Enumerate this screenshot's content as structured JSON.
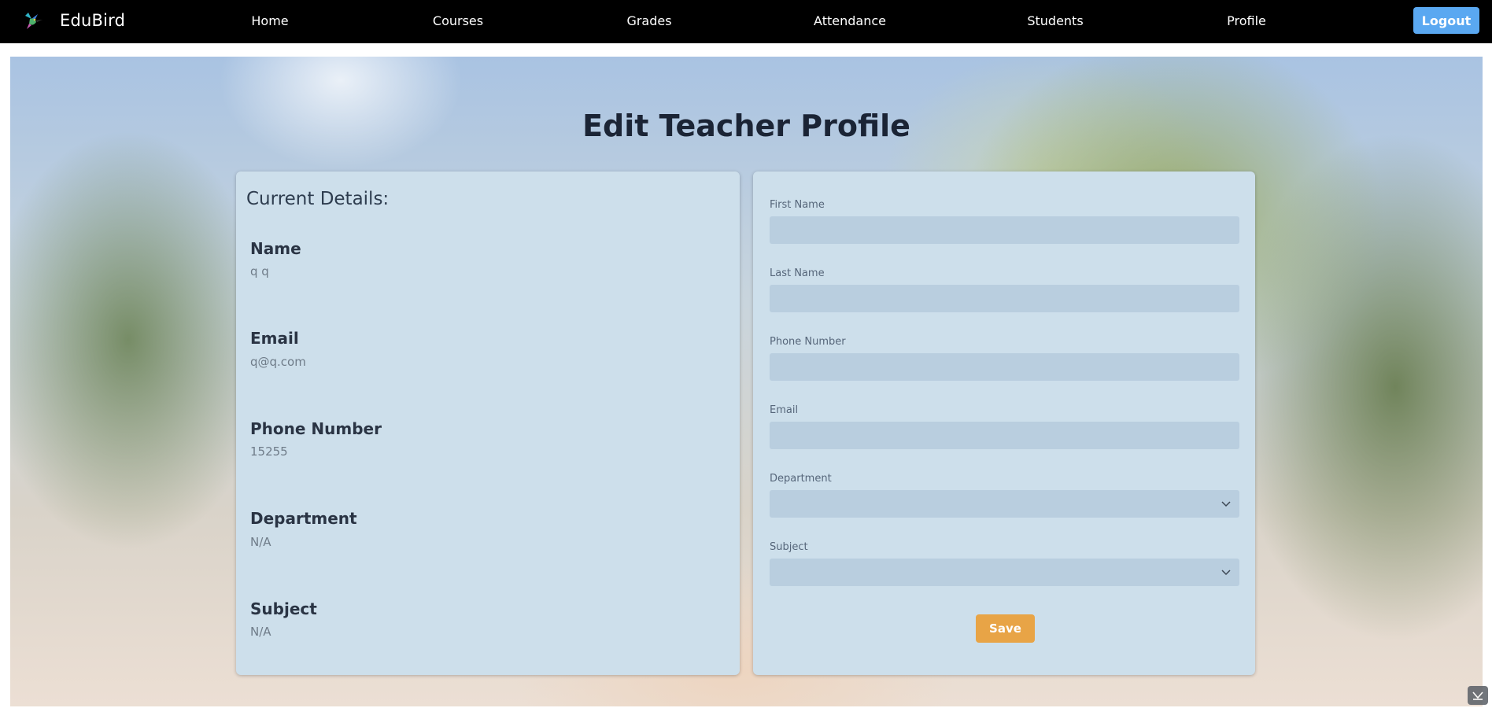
{
  "nav": {
    "brand": "EduBird",
    "links": [
      "Home",
      "Courses",
      "Grades",
      "Attendance",
      "Students",
      "Profile"
    ],
    "logout_label": "Logout"
  },
  "page": {
    "title": "Edit Teacher Profile"
  },
  "current_details": {
    "heading": "Current Details:",
    "items": [
      {
        "label": "Name",
        "value": "q q"
      },
      {
        "label": "Email",
        "value": "q@q.com"
      },
      {
        "label": "Phone Number",
        "value": "15255"
      },
      {
        "label": "Department",
        "value": "N/A"
      },
      {
        "label": "Subject",
        "value": "N/A"
      }
    ]
  },
  "form": {
    "first_name": {
      "label": "First Name",
      "value": ""
    },
    "last_name": {
      "label": "Last Name",
      "value": ""
    },
    "phone_number": {
      "label": "Phone Number",
      "value": ""
    },
    "email": {
      "label": "Email",
      "value": ""
    },
    "department": {
      "label": "Department",
      "selected": ""
    },
    "subject": {
      "label": "Subject",
      "selected": ""
    },
    "save_label": "Save"
  },
  "colors": {
    "navbar": "#000000",
    "logout_button": "#5aa8f1",
    "save_button": "#e8a446",
    "panel": "#cddfeb",
    "input": "#b9cedf",
    "title": "#1b2435"
  },
  "icons": {
    "brand": "hummingbird-logo-icon",
    "select_arrow": "chevron-down-icon",
    "corner_widget": "collapse-arrow-icon"
  }
}
